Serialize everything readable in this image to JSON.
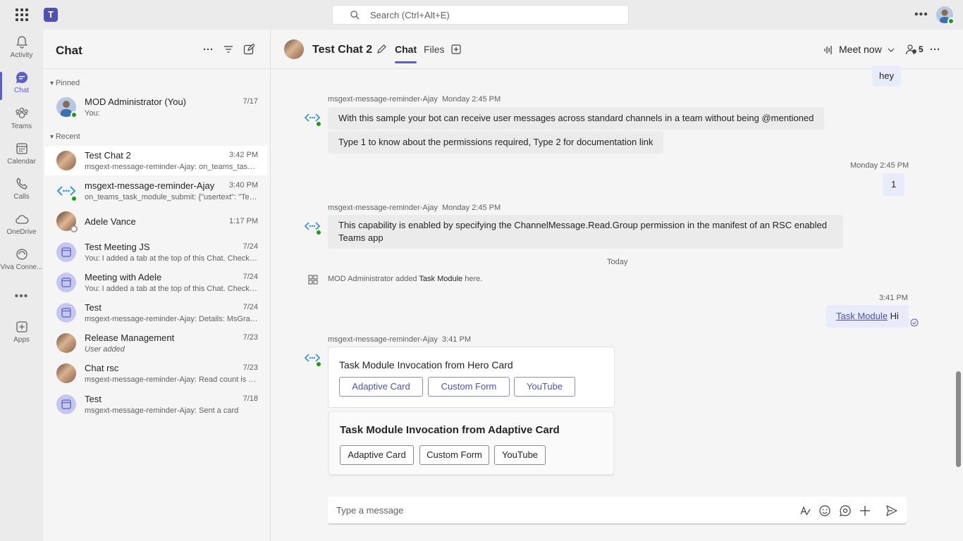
{
  "search": {
    "placeholder": "Search (Ctrl+Alt+E)"
  },
  "rail": [
    {
      "label": "Activity",
      "icon": "bell-icon"
    },
    {
      "label": "Chat",
      "icon": "chat-icon"
    },
    {
      "label": "Teams",
      "icon": "teams-icon"
    },
    {
      "label": "Calendar",
      "icon": "calendar-icon"
    },
    {
      "label": "Calls",
      "icon": "phone-icon"
    },
    {
      "label": "OneDrive",
      "icon": "cloud-icon"
    },
    {
      "label": "Viva Conne...",
      "icon": "viva-icon"
    },
    {
      "label": "Apps",
      "icon": "add-app-icon"
    }
  ],
  "list": {
    "title": "Chat",
    "pinned_label": "Pinned",
    "recent_label": "Recent",
    "pinned": [
      {
        "name": "MOD Administrator (You)",
        "time": "7/17",
        "preview": "You:"
      }
    ],
    "recent": [
      {
        "name": "Test Chat 2",
        "time": "3:42 PM",
        "preview": "msgext-message-reminder-Ajay: on_teams_task_..."
      },
      {
        "name": "msgext-message-reminder-Ajay",
        "time": "3:40 PM",
        "preview": "on_teams_task_module_submit: {\"usertext\": \"Testi..."
      },
      {
        "name": "Adele Vance",
        "time": "1:17 PM",
        "preview": ""
      },
      {
        "name": "Test Meeting JS",
        "time": "7/24",
        "preview": "You: I added a tab at the top of this Chat. Check it..."
      },
      {
        "name": "Meeting with Adele",
        "time": "7/24",
        "preview": "You: I added a tab at the top of this Chat. Check it..."
      },
      {
        "name": "Test",
        "time": "7/24",
        "preview": "msgext-message-reminder-Ajay: Details:   MsGrap..."
      },
      {
        "name": "Release Management",
        "time": "7/23",
        "preview": "User added"
      },
      {
        "name": "Chat rsc",
        "time": "7/23",
        "preview": "msgext-message-reminder-Ajay: Read count is ze..."
      },
      {
        "name": "Test",
        "time": "7/18",
        "preview": "msgext-message-reminder-Ajay: Sent a card"
      }
    ]
  },
  "header": {
    "title": "Test Chat 2",
    "tab_chat": "Chat",
    "tab_files": "Files",
    "meet_now": "Meet now",
    "participants": "5"
  },
  "messages": {
    "hey": "hey",
    "bot1_name": "msgext-message-reminder-Ajay",
    "bot1_time": "Monday 2:45 PM",
    "bot1_text1": "With this sample your bot can receive user messages across standard channels in a team without being @mentioned",
    "bot1_text2": "Type 1 to know about the permissions required, Type 2 for documentation link",
    "my1_time": "Monday 2:45 PM",
    "my1_text": "1",
    "bot2_name": "msgext-message-reminder-Ajay",
    "bot2_time": "Monday 2:45 PM",
    "bot2_text": "This capability is enabled by specifying the ChannelMessage.Read.Group permission in the manifest of an RSC enabled Teams app",
    "divider": "Today",
    "event_pre": "MOD Administrator added ",
    "event_app": "Task Module",
    "event_post": " here.",
    "my2_time": "3:41 PM",
    "my2_link": "Task Module",
    "my2_text": " Hi",
    "bot3_name": "msgext-message-reminder-Ajay",
    "bot3_time": "3:41 PM",
    "card1_title": "Task Module Invocation from Hero Card",
    "card1_buttons": [
      "Adaptive Card",
      "Custom Form",
      "YouTube"
    ],
    "card2_title": "Task Module Invocation from Adaptive Card",
    "card2_buttons": [
      "Adaptive Card",
      "Custom Form",
      "YouTube"
    ]
  },
  "composer": {
    "placeholder": "Type a message"
  },
  "colors": {
    "accent": "#5b5fc7",
    "status_available": "#13a10e"
  }
}
